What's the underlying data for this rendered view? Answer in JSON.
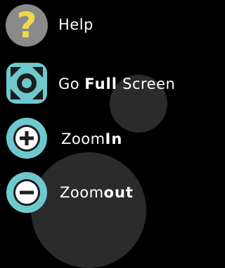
{
  "menu": {
    "help": {
      "label": "Help",
      "icon": "question-mark-icon"
    },
    "full_screen": {
      "label_pre": "Go ",
      "label_bold": "Full",
      "label_post": " Screen",
      "icon": "fullscreen-icon"
    },
    "zoom_in": {
      "label_pre": "Zoom",
      "label_bold": "In",
      "icon": "plus-circle-icon"
    },
    "zoom_out": {
      "label_pre": "Zoom",
      "label_bold": "out",
      "icon": "minus-circle-icon"
    }
  },
  "colors": {
    "help_icon_bg": "#8a8a8a",
    "help_icon_mark": "#f2d84a",
    "accent": "#6ec9cf",
    "icon_dark": "#1d1d1d",
    "background": "#000000",
    "text": "#ffffff"
  },
  "help_icon_glyph": "?"
}
